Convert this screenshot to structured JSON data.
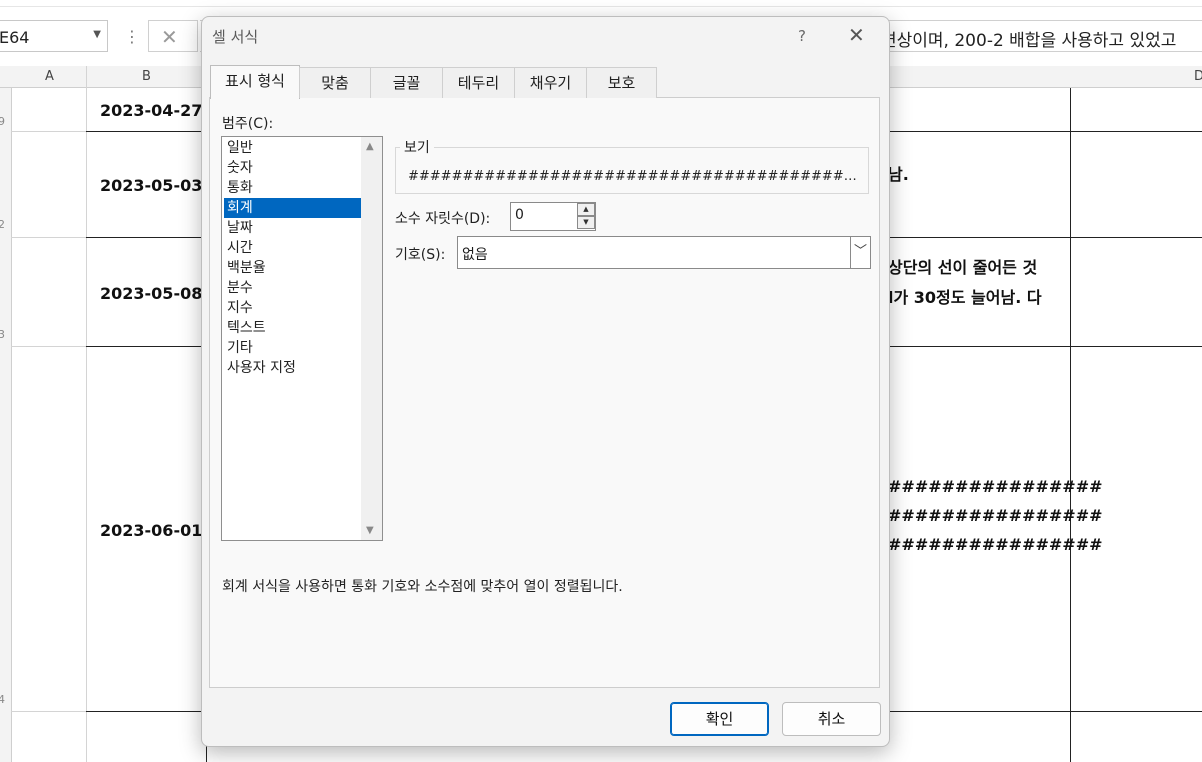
{
  "sheet": {
    "name_box": "E64",
    "formula_text": "변상이며, 200-2 배합을 사용하고 있었고",
    "col_headers": [
      "A",
      "B",
      "D"
    ],
    "row_numbers": [
      "9",
      "2",
      "3",
      "4"
    ],
    "dates": [
      "2023-04-27",
      "2023-05-03",
      "2023-05-08",
      "2023-06-01"
    ],
    "cell_texts": [
      "남.",
      "상단의 선이 줄어든 것",
      "l가 30정도 늘어남. 다",
      "################",
      "################",
      "################"
    ]
  },
  "dialog": {
    "title": "셀 서식",
    "help": "?",
    "close": "✕",
    "tabs": [
      "표시 형식",
      "맞춤",
      "글꼴",
      "테두리",
      "채우기",
      "보호"
    ],
    "category_label": "범주(C):",
    "categories": [
      "일반",
      "숫자",
      "통화",
      "회계",
      "날짜",
      "시간",
      "백분율",
      "분수",
      "지수",
      "텍스트",
      "기타",
      "사용자 지정"
    ],
    "selected_category": "회계",
    "sample_label": "보기",
    "sample_value": "##################################################...",
    "decimal_label": "소수 자릿수(D):",
    "decimal_value": "0",
    "symbol_label": "기호(S):",
    "symbol_value": "없음",
    "description": "회계 서식을 사용하면 통화 기호와 소수점에 맞추어 열이 정렬됩니다.",
    "ok_label": "확인",
    "cancel_label": "취소"
  }
}
